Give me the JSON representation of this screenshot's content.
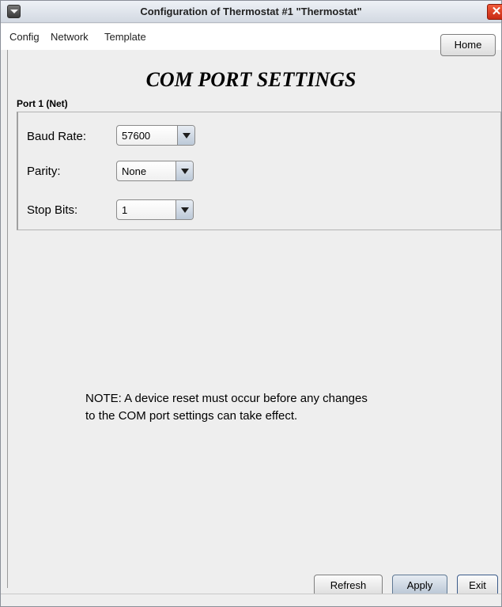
{
  "window": {
    "title": "Configuration of Thermostat #1 \"Thermostat\"",
    "close_glyph": "✕"
  },
  "menu": {
    "items": [
      "Config",
      "Network",
      "Template"
    ],
    "home_label": "Home"
  },
  "page": {
    "title": "COM PORT SETTINGS"
  },
  "port": {
    "group_label": "Port 1 (Net)",
    "fields": [
      {
        "label": "Baud Rate:",
        "value": "57600"
      },
      {
        "label": "Parity:",
        "value": "None"
      },
      {
        "label": "Stop Bits:",
        "value": "1"
      }
    ]
  },
  "note": {
    "line1": "NOTE: A device reset must occur before any changes",
    "line2": "to the COM port settings can take effect."
  },
  "footer": {
    "refresh_label": "Refresh",
    "apply_label": "Apply",
    "exit_label": "Exit"
  },
  "icons": {
    "system_menu": "chevron-down-icon",
    "close": "close-icon",
    "dropdown": "dropdown-arrow-icon"
  }
}
